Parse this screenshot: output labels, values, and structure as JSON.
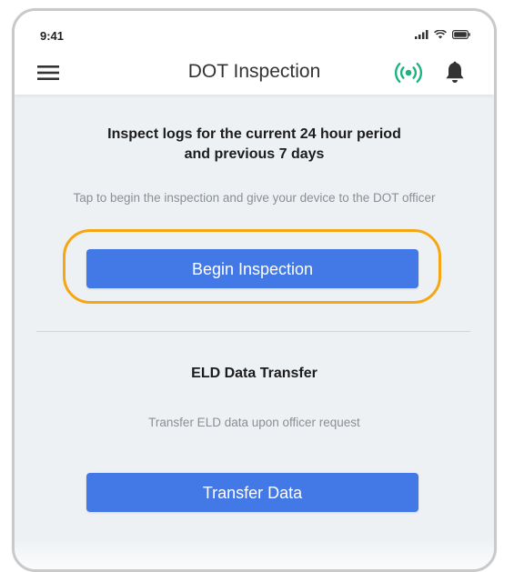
{
  "status_bar": {
    "time": "9:41",
    "icons": [
      "cellular-signal-icon",
      "wifi-icon",
      "battery-icon"
    ]
  },
  "header": {
    "title": "DOT Inspection",
    "menu_icon": "hamburger-menu-icon",
    "connection_icon": "connected-broadcast-icon",
    "notification_icon": "bell-icon"
  },
  "inspection": {
    "heading_line1": "Inspect logs for the current 24 hour period",
    "heading_line2": "and previous 7 days",
    "hint": "Tap to begin the inspection and give your device to the DOT officer",
    "button_label": "Begin Inspection"
  },
  "transfer": {
    "heading": "ELD Data Transfer",
    "hint": "Transfer ELD data upon officer request",
    "button_label": "Transfer Data"
  },
  "colors": {
    "primary_button": "#4279e6",
    "highlight_ring": "#f5a613",
    "connected_status": "#1db37e",
    "content_background": "#eef1f4"
  }
}
